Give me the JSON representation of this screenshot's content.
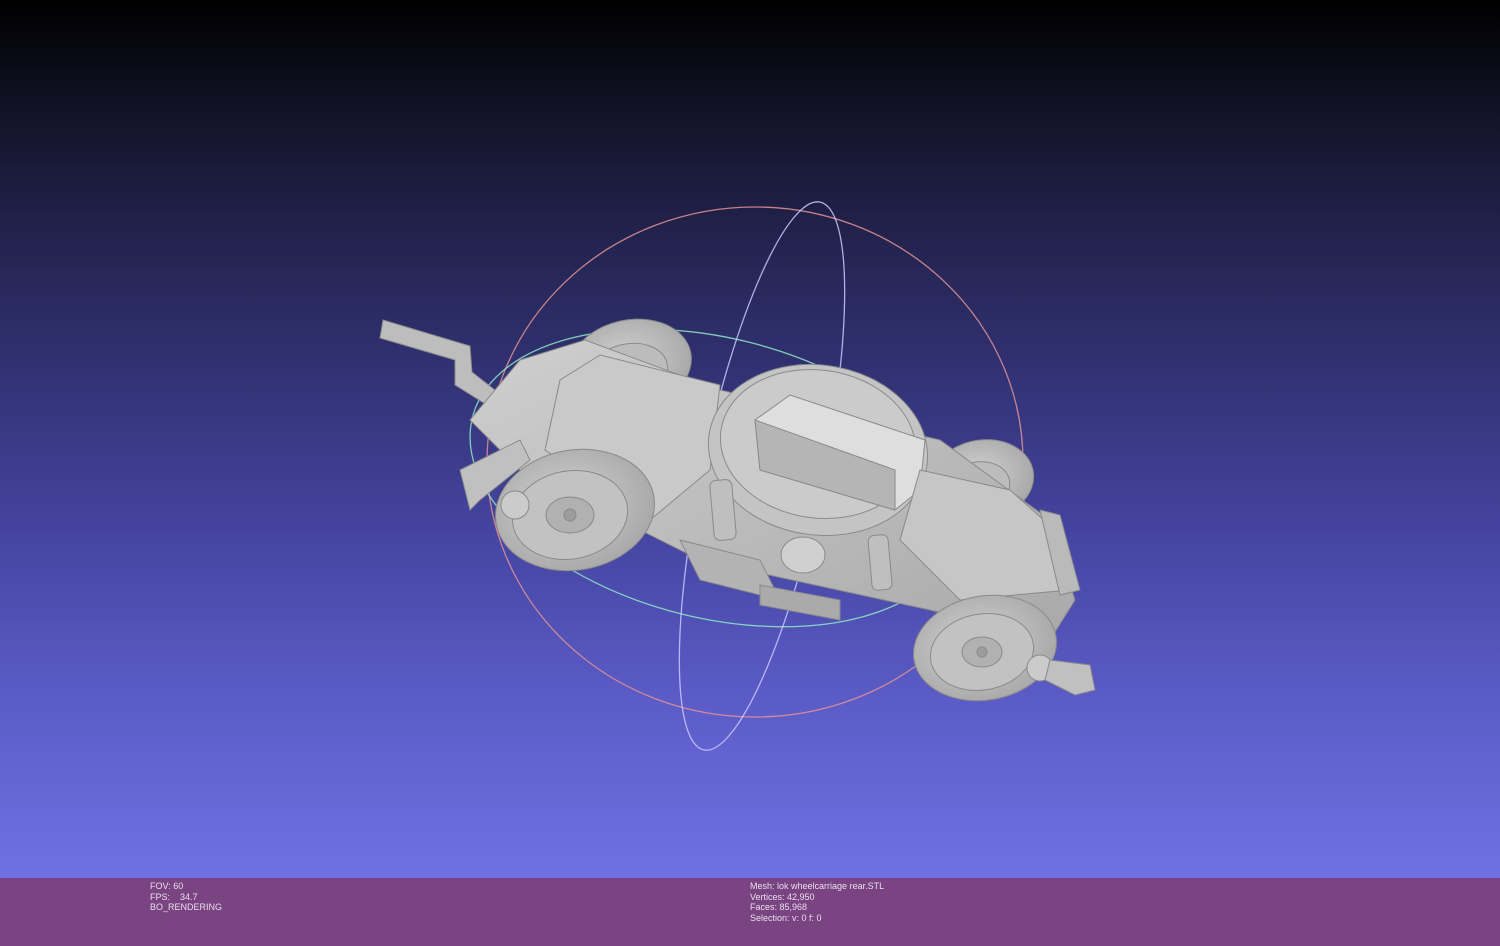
{
  "viewer": {
    "colors": {
      "background_top": "#000000",
      "background_bottom": "#7070e4",
      "statusbar": "#7a4382",
      "mesh": "#c8c8c8",
      "trackball_red": "#e88a8a",
      "trackball_green": "#8aeac0",
      "trackball_blue": "#c8c8ff"
    }
  },
  "status_left": {
    "fov_label": "FOV:",
    "fov_value": "60",
    "fps_label": "FPS:",
    "fps_value": "34.7",
    "render_mode": "BO_RENDERING"
  },
  "status_right": {
    "mesh_label": "Mesh:",
    "mesh_name": "lok wheelcarriage rear.STL",
    "vertices_label": "Vertices:",
    "vertices_value": "42,950",
    "faces_label": "Faces:",
    "faces_value": "85,968",
    "selection_label": "Selection:",
    "selection_value": "v: 0 f: 0"
  }
}
